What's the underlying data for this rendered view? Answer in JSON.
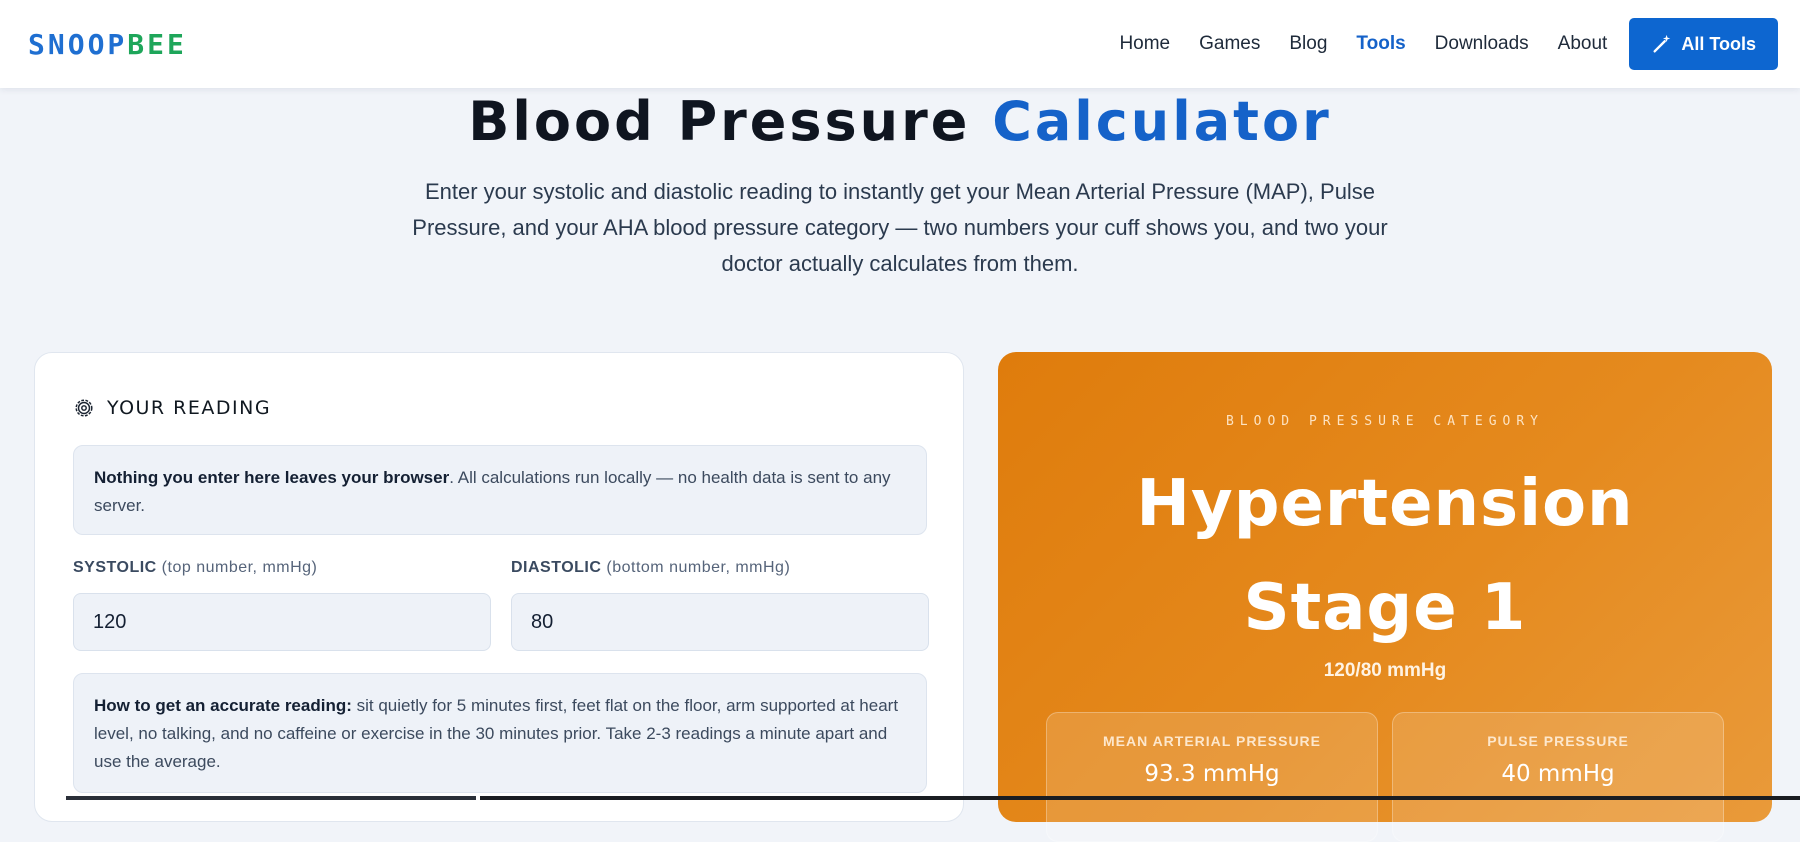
{
  "header": {
    "logo_part1": "SNOOP",
    "logo_part2": "BEE",
    "nav": [
      "Home",
      "Games",
      "Blog",
      "Tools",
      "Downloads",
      "About"
    ],
    "active_nav": "Tools",
    "all_tools_label": "All Tools",
    "colors": {
      "brand_blue": "#1f6fd1",
      "brand_green": "#1ea65a",
      "button": "#0d66d0"
    }
  },
  "hero": {
    "title_main": "Blood Pressure",
    "title_accent": "Calculator",
    "description": "Enter your systolic and diastolic reading to instantly get your Mean Arterial Pressure (MAP), Pulse Pressure, and your AHA blood pressure category — two numbers your cuff shows you, and two your doctor actually calculates from them."
  },
  "form": {
    "heading": "YOUR READING",
    "privacy_bold": "Nothing you enter here leaves your browser",
    "privacy_rest": ". All calculations run locally — no health data is sent to any server.",
    "systolic_label": "SYSTOLIC",
    "systolic_hint": "(top number, mmHg)",
    "systolic_value": "120",
    "diastolic_label": "DIASTOLIC",
    "diastolic_hint": "(bottom number, mmHg)",
    "diastolic_value": "80",
    "tip_bold": "How to get an accurate reading:",
    "tip_rest": " sit quietly for 5 minutes first, feet flat on the floor, arm supported at heart level, no talking, and no caffeine or exercise in the 30 minutes prior. Take 2-3 readings a minute apart and use the average."
  },
  "result": {
    "category_label": "BLOOD PRESSURE CATEGORY",
    "category_value": "Hypertension Stage 1",
    "reading": "120/80 mmHg",
    "map_label": "MEAN ARTERIAL PRESSURE",
    "map_value": "93.3 mmHg",
    "pp_label": "PULSE PRESSURE",
    "pp_value": "40 mmHg",
    "color": "#df7c0c"
  }
}
